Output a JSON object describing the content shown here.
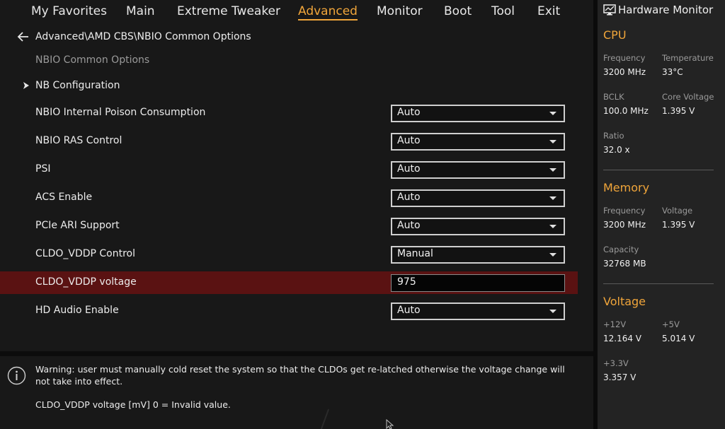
{
  "menu": {
    "items": [
      {
        "label": "My Favorites",
        "active": false
      },
      {
        "label": "Main",
        "active": false
      },
      {
        "label": "Extreme Tweaker",
        "active": false
      },
      {
        "label": "Advanced",
        "active": true
      },
      {
        "label": "Monitor",
        "active": false
      },
      {
        "label": "Boot",
        "active": false
      },
      {
        "label": "Tool",
        "active": false
      },
      {
        "label": "Exit",
        "active": false
      }
    ]
  },
  "breadcrumb": "Advanced\\AMD CBS\\NBIO Common Options",
  "section_title": "NBIO Common Options",
  "submenu": {
    "label": "NB Configuration"
  },
  "options": [
    {
      "label": "NBIO Internal Poison Consumption",
      "value": "Auto",
      "control": "dropdown"
    },
    {
      "label": "NBIO RAS Control",
      "value": "Auto",
      "control": "dropdown"
    },
    {
      "label": "PSI",
      "value": "Auto",
      "control": "dropdown"
    },
    {
      "label": "ACS Enable",
      "value": "Auto",
      "control": "dropdown"
    },
    {
      "label": "PCIe ARI Support",
      "value": "Auto",
      "control": "dropdown"
    },
    {
      "label": "CLDO_VDDP Control",
      "value": "Manual",
      "control": "dropdown"
    },
    {
      "label": "CLDO_VDDP voltage",
      "value": "975",
      "control": "text",
      "highlighted": true
    },
    {
      "label": "HD Audio Enable",
      "value": "Auto",
      "control": "dropdown"
    }
  ],
  "info": {
    "warning": "Warning: user must manually cold reset the system so that the CLDOs get re-latched otherwise the voltage change will not take into effect.",
    "note": "CLDO_VDDP voltage [mV] 0 = Invalid value."
  },
  "hw_monitor": {
    "title": "Hardware Monitor",
    "cpu": {
      "title": "CPU",
      "frequency_label": "Frequency",
      "frequency": "3200 MHz",
      "temperature_label": "Temperature",
      "temperature": "33°C",
      "bclk_label": "BCLK",
      "bclk": "100.0 MHz",
      "core_voltage_label": "Core Voltage",
      "core_voltage": "1.395 V",
      "ratio_label": "Ratio",
      "ratio": "32.0 x"
    },
    "memory": {
      "title": "Memory",
      "frequency_label": "Frequency",
      "frequency": "3200 MHz",
      "voltage_label": "Voltage",
      "voltage": "1.395 V",
      "capacity_label": "Capacity",
      "capacity": "32768 MB"
    },
    "voltage": {
      "title": "Voltage",
      "v12_label": "+12V",
      "v12": "12.164 V",
      "v5_label": "+5V",
      "v5": "5.014 V",
      "v33_label": "+3.3V",
      "v33": "3.357 V"
    }
  },
  "colors": {
    "accent": "#f0a53a",
    "highlight_row": "#5a1212",
    "background": "#181818",
    "monitor_bg": "#232323"
  },
  "icons": [
    "back-arrow-icon",
    "chevron-right-icon",
    "info-icon",
    "monitor-icon",
    "dropdown-caret-icon"
  ]
}
